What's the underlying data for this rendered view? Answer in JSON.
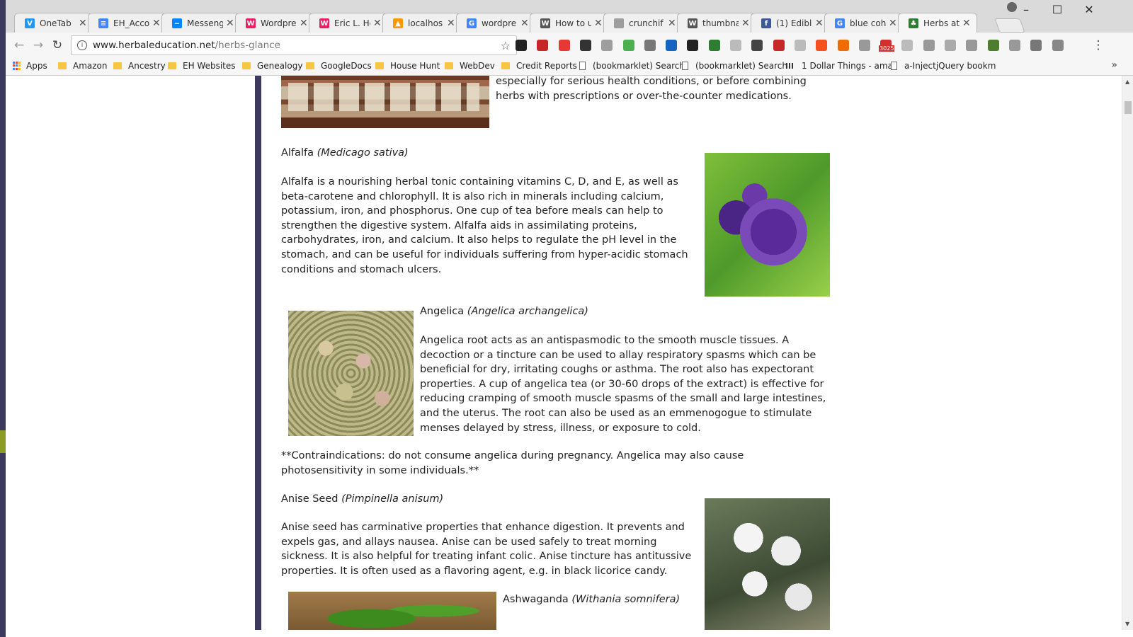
{
  "tabs": [
    {
      "title": "OneTab",
      "icon": "onetab-icon",
      "color": "#2196f3",
      "glyph": "V"
    },
    {
      "title": "EH_Acco",
      "icon": "docs-icon",
      "color": "#4285f4",
      "glyph": "≡"
    },
    {
      "title": "Messeng",
      "icon": "messenger-icon",
      "color": "#0084ff",
      "glyph": "~"
    },
    {
      "title": "Wordpre",
      "icon": "wordpress-icon",
      "color": "#e91e63",
      "glyph": "W"
    },
    {
      "title": "Eric L. He",
      "icon": "wordpress-icon",
      "color": "#e91e63",
      "glyph": "W"
    },
    {
      "title": "localhos",
      "icon": "localhost-icon",
      "color": "#ff9800",
      "glyph": "▲"
    },
    {
      "title": "wordpre",
      "icon": "google-icon",
      "color": "#4285f4",
      "glyph": "G"
    },
    {
      "title": "How to u",
      "icon": "wikipedia-icon",
      "color": "#555555",
      "glyph": "W"
    },
    {
      "title": "crunchif",
      "icon": "page-icon",
      "color": "#9e9e9e",
      "glyph": ""
    },
    {
      "title": "thumbna",
      "icon": "wikipedia-icon",
      "color": "#555555",
      "glyph": "W"
    },
    {
      "title": "(1) Edibl",
      "icon": "facebook-icon",
      "color": "#3b5998",
      "glyph": "f"
    },
    {
      "title": "blue coh",
      "icon": "google-icon",
      "color": "#4285f4",
      "glyph": "G"
    },
    {
      "title": "Herbs at",
      "icon": "herb-leaf-icon",
      "color": "#2e7d32",
      "glyph": "♣"
    }
  ],
  "address": {
    "host": "www.herbaleducation.net",
    "path": "/herbs-glance"
  },
  "bookmarks": [
    {
      "label": "Apps",
      "kind": "apps"
    },
    {
      "label": "Amazon",
      "kind": "folder"
    },
    {
      "label": "Ancestry",
      "kind": "folder"
    },
    {
      "label": "EH Websites",
      "kind": "folder"
    },
    {
      "label": "Genealogy",
      "kind": "folder"
    },
    {
      "label": "GoogleDocs",
      "kind": "folder"
    },
    {
      "label": "House Hunt",
      "kind": "folder"
    },
    {
      "label": "WebDev",
      "kind": "folder"
    },
    {
      "label": "Credit Reports",
      "kind": "folder"
    },
    {
      "label": "(bookmarklet) Search",
      "kind": "page"
    },
    {
      "label": "(bookmarklet) Search",
      "kind": "page"
    },
    {
      "label": "1 Dollar Things - ama",
      "kind": "bar"
    },
    {
      "label": "a-InjectjQuery bookm",
      "kind": "page"
    }
  ],
  "extensions": [
    "amazon-icon",
    "adobe-icon",
    "pocket-icon",
    "eyedropper-icon",
    "cloud-icon",
    "google-translate-icon",
    "wifi-icon",
    "vimeo-icon",
    "gear-icon",
    "grammarly-icon",
    "screen-icon",
    "car-icon",
    "pinterest-icon",
    "print-icon",
    "plus-icon",
    "key-icon",
    "grid-icon",
    "gmail-icon",
    "ruler-icon",
    "x-icon",
    "c-icon",
    "panel-icon",
    "color-icon",
    "tag-icon",
    "lastpass-icon",
    "globe-icon"
  ],
  "gmail_badge": "3025",
  "page": {
    "intro": "especially for serious health conditions, or before combining herbs with prescriptions or over-the-counter medications.",
    "herbs": [
      {
        "name": "Alfalfa",
        "latin": "(Medicago sativa)",
        "body": "Alfalfa is a nourishing herbal tonic containing vitamins C, D, and E, as well as beta-carotene and chlorophyll.  It is also rich in minerals including calcium, potassium, iron, and phosphorus.  One cup of tea before meals can help to strengthen the digestive system.  Alfalfa aids in assimilating proteins, carbohydrates, iron, and calcium.  It also helps to regulate the pH level in the stomach, and can be useful for individuals suffering from hyper-acidic stomach conditions and stomach ulcers."
      },
      {
        "name": "Angelica",
        "latin": "(Angelica archangelica)",
        "body": "Angelica root acts as an antispasmodic to the smooth muscle tissues.  A decoction or a tincture can be used to allay respiratory spasms which can be beneficial for dry, irritating coughs or asthma.  The root also has expectorant properties.  A cup of angelica tea (or 30-60 drops of the extract) is effective for reducing cramping of smooth muscle spasms of the small and large intestines, and the uterus.  The root can also be used as an emmenogogue to stimulate menses delayed by stress, illness, or exposure to cold.",
        "note": "**Contraindications: do not consume angelica during pregnancy.  Angelica may also cause photosensitivity in some individuals.**"
      },
      {
        "name": "Anise Seed",
        "latin": "(Pimpinella anisum)",
        "body": "Anise seed has carminative properties that enhance digestion.  It prevents and expels gas, and allays nausea.  Anise can be used safely to treat morning sickness.  It is also helpful for treating infant colic.  Anise tincture has antitussive properties.  It is often used as a flavoring agent, e.g. in black licorice candy."
      },
      {
        "name": "Ashwaganda",
        "latin": "(Withania somnifera)"
      }
    ]
  }
}
